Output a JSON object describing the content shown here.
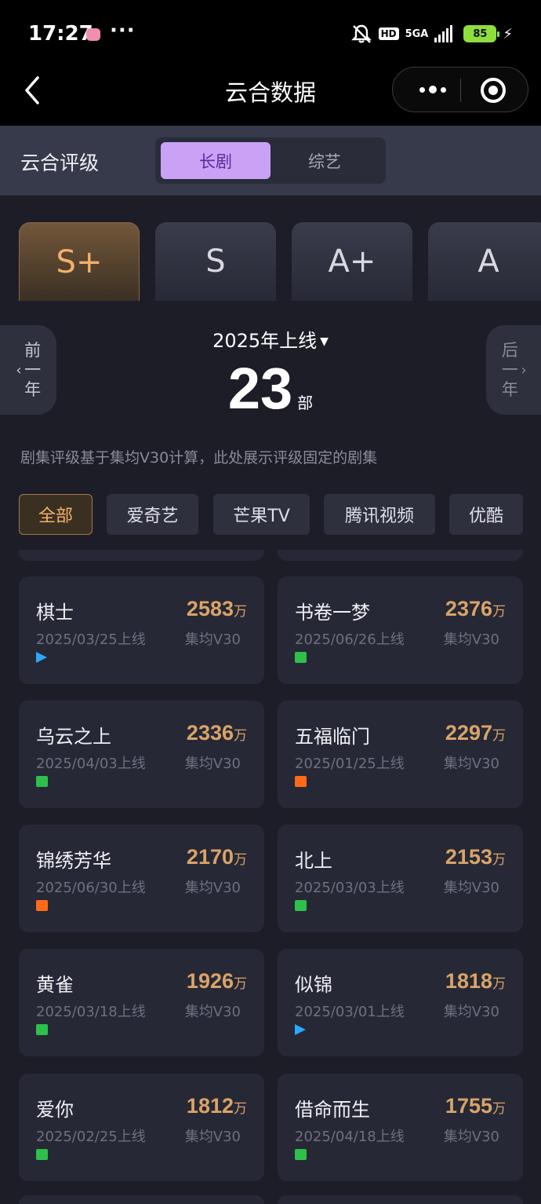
{
  "status": {
    "time": "17:27",
    "dots": "···",
    "hd": "HD",
    "network": "5GA",
    "battery": "85"
  },
  "nav": {
    "title": "云合数据"
  },
  "section": {
    "title": "云合评级",
    "toggle": [
      "长剧",
      "综艺"
    ]
  },
  "grades": [
    "S+",
    "S",
    "A+",
    "A"
  ],
  "year": {
    "title": "2025年上线",
    "prev": [
      "前",
      "一",
      "年"
    ],
    "next": [
      "后",
      "一",
      "年"
    ],
    "count": "23",
    "unit": "部"
  },
  "note": "剧集评级基于集均V30计算，此处展示评级固定的剧集",
  "platforms": [
    "全部",
    "爱奇艺",
    "芒果TV",
    "腾讯视频",
    "优酷"
  ],
  "metric_label": "集均V30",
  "value_unit": "万",
  "shows": [
    {
      "title": "棋士",
      "date": "2025/03/25上线",
      "value": "2583",
      "platform_icon": "tencent-video-icon"
    },
    {
      "title": "书卷一梦",
      "date": "2025/06/26上线",
      "value": "2376",
      "platform_icon": "iqiyi-icon"
    },
    {
      "title": "乌云之上",
      "date": "2025/04/03上线",
      "value": "2336",
      "platform_icon": "iqiyi-icon"
    },
    {
      "title": "五福临门",
      "date": "2025/01/25上线",
      "value": "2297",
      "platform_icon": "mgtv-icon"
    },
    {
      "title": "锦绣芳华",
      "date": "2025/06/30上线",
      "value": "2170",
      "platform_icon": "mgtv-icon"
    },
    {
      "title": "北上",
      "date": "2025/03/03上线",
      "value": "2153",
      "platform_icon": "iqiyi-icon"
    },
    {
      "title": "黄雀",
      "date": "2025/03/18上线",
      "value": "1926",
      "platform_icon": "iqiyi-icon"
    },
    {
      "title": "似锦",
      "date": "2025/03/01上线",
      "value": "1818",
      "platform_icon": "tencent-video-icon"
    },
    {
      "title": "爱你",
      "date": "2025/02/25上线",
      "value": "1812",
      "platform_icon": "iqiyi-icon"
    },
    {
      "title": "借命而生",
      "date": "2025/04/18上线",
      "value": "1755",
      "platform_icon": "iqiyi-icon"
    }
  ],
  "colors": {
    "accent_gold": "#d9a468",
    "toggle_purple": "#c9a2f6",
    "background": "#1d1d28"
  }
}
